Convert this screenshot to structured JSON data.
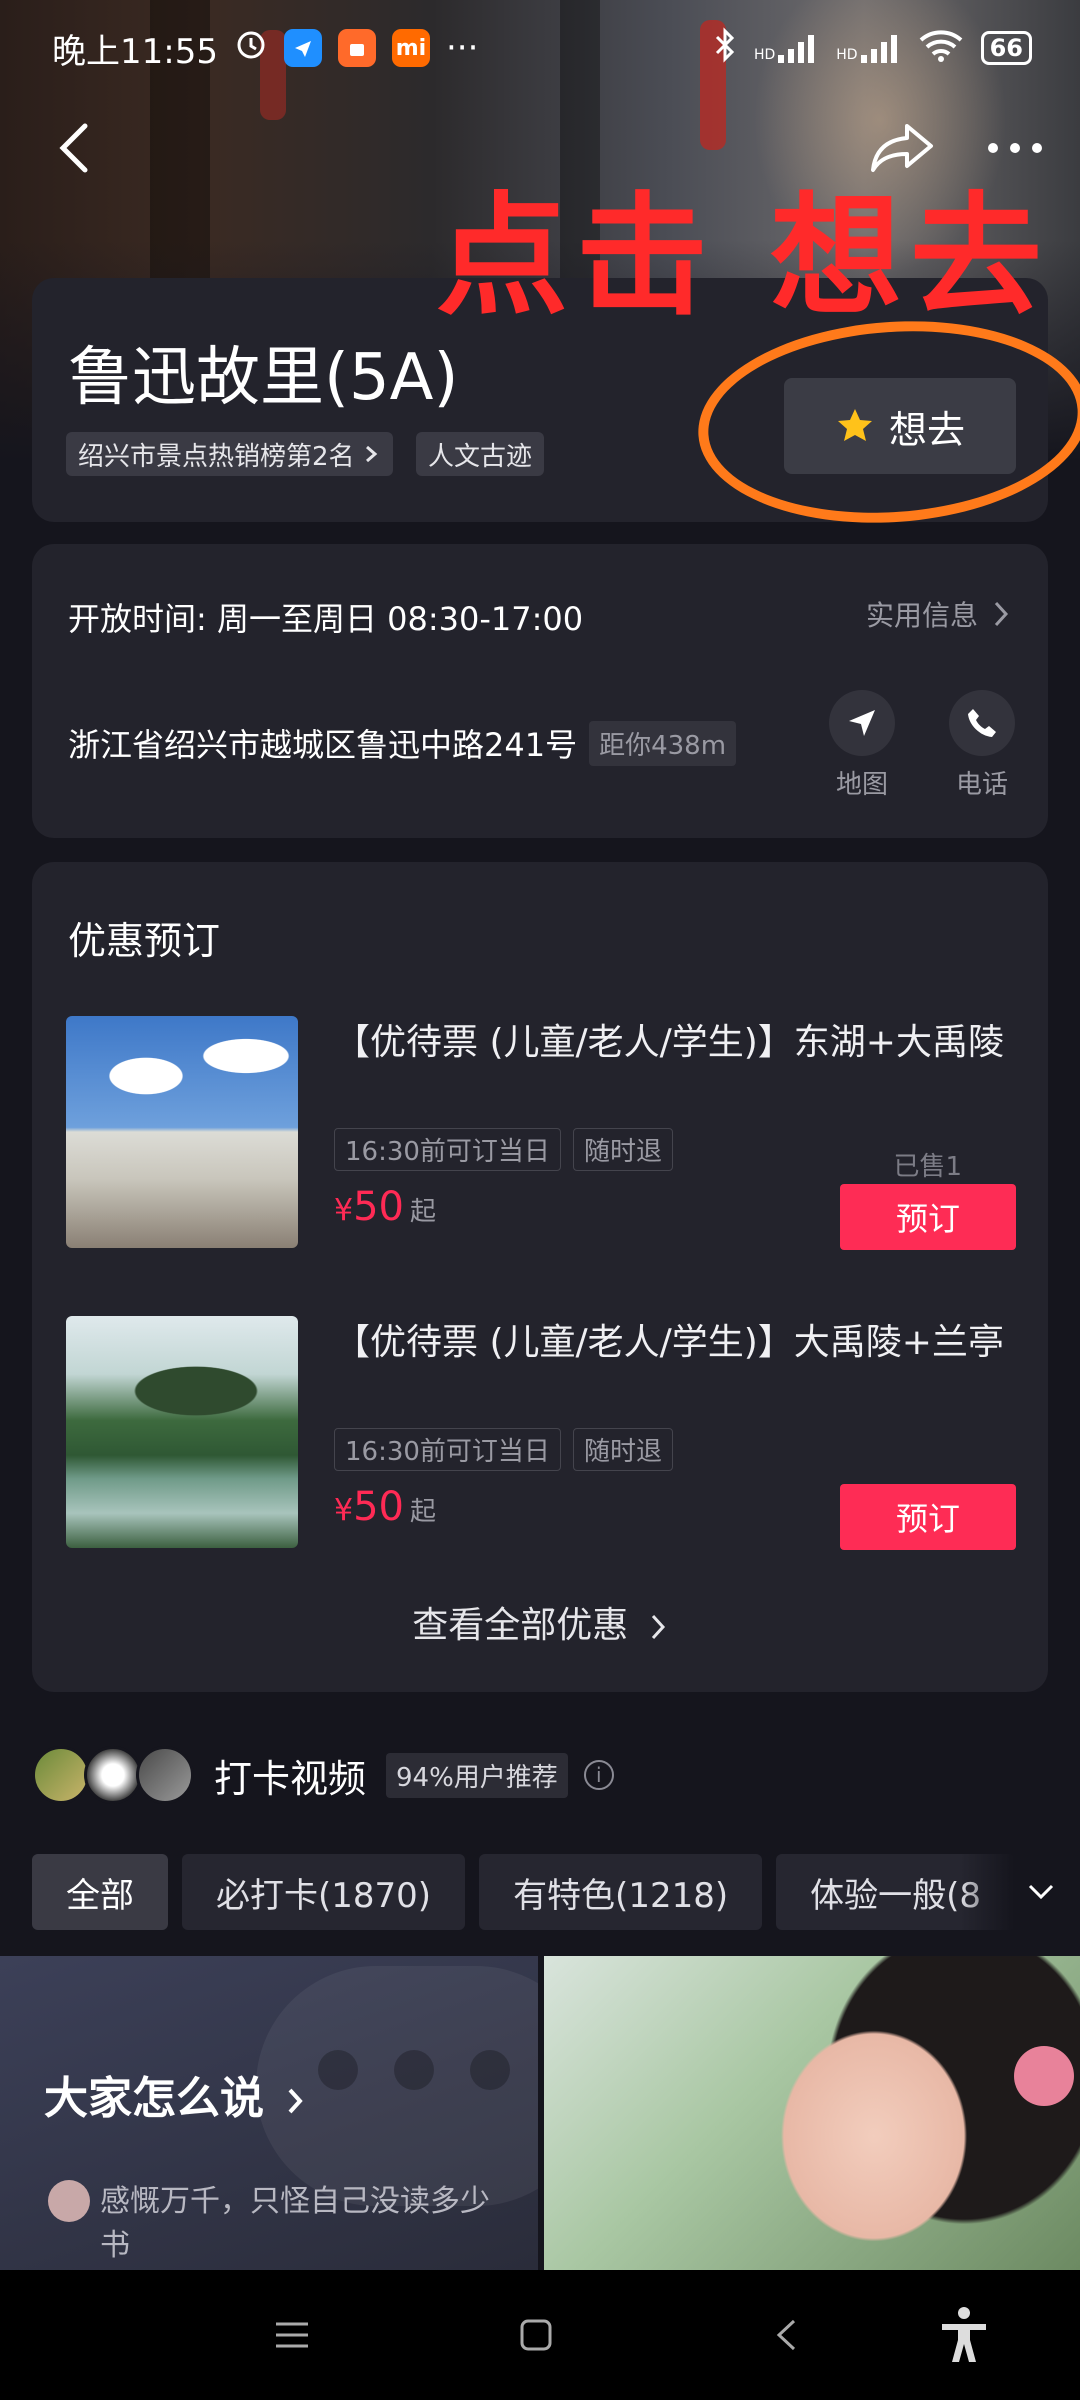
{
  "status_bar": {
    "time": "晚上11:55",
    "battery": "66",
    "signal_label_1": "HD",
    "signal_label_2": "HD",
    "more": "···"
  },
  "overlay": {
    "annotation_text": "点击 想去",
    "annotation_color": "#ff2a2a",
    "circle_color": "#ff7a1a"
  },
  "attraction": {
    "title": "鲁迅故里(5A)",
    "rank_tag": "绍兴市景点热销榜第2名",
    "category_tag": "人文古迹",
    "want_label": "想去"
  },
  "info": {
    "hours": "开放时间: 周一至周日 08:30-17:00",
    "useful_info": "实用信息",
    "address": "浙江省绍兴市越城区鲁迅中路241号",
    "distance": "距你438m",
    "map_label": "地图",
    "phone_label": "电话"
  },
  "deals": {
    "section_title": "优惠预订",
    "items": [
      {
        "title": "【优待票 (儿童/老人/学生)】东湖+大禹陵",
        "chips": [
          "16:30前可订当日",
          "随时退"
        ],
        "currency": "¥",
        "price": "50",
        "from": "起",
        "sold": "已售1",
        "book_label": "预订"
      },
      {
        "title": "【优待票 (儿童/老人/学生)】大禹陵+兰亭",
        "chips": [
          "16:30前可订当日",
          "随时退"
        ],
        "currency": "¥",
        "price": "50",
        "from": "起",
        "sold": "",
        "book_label": "预订"
      }
    ],
    "see_all": "查看全部优惠"
  },
  "videos": {
    "title": "打卡视频",
    "recommend": "94%用户推荐",
    "filters": [
      "全部",
      "必打卡(1870)",
      "有特色(1218)",
      "体验一般(8"
    ],
    "everyone_says": "大家怎么说",
    "comment": "感慨万千，只怪自己没读多少书"
  },
  "colors": {
    "accent": "#fe2c55",
    "card_bg": "#23232c",
    "page_bg": "#15151d"
  }
}
